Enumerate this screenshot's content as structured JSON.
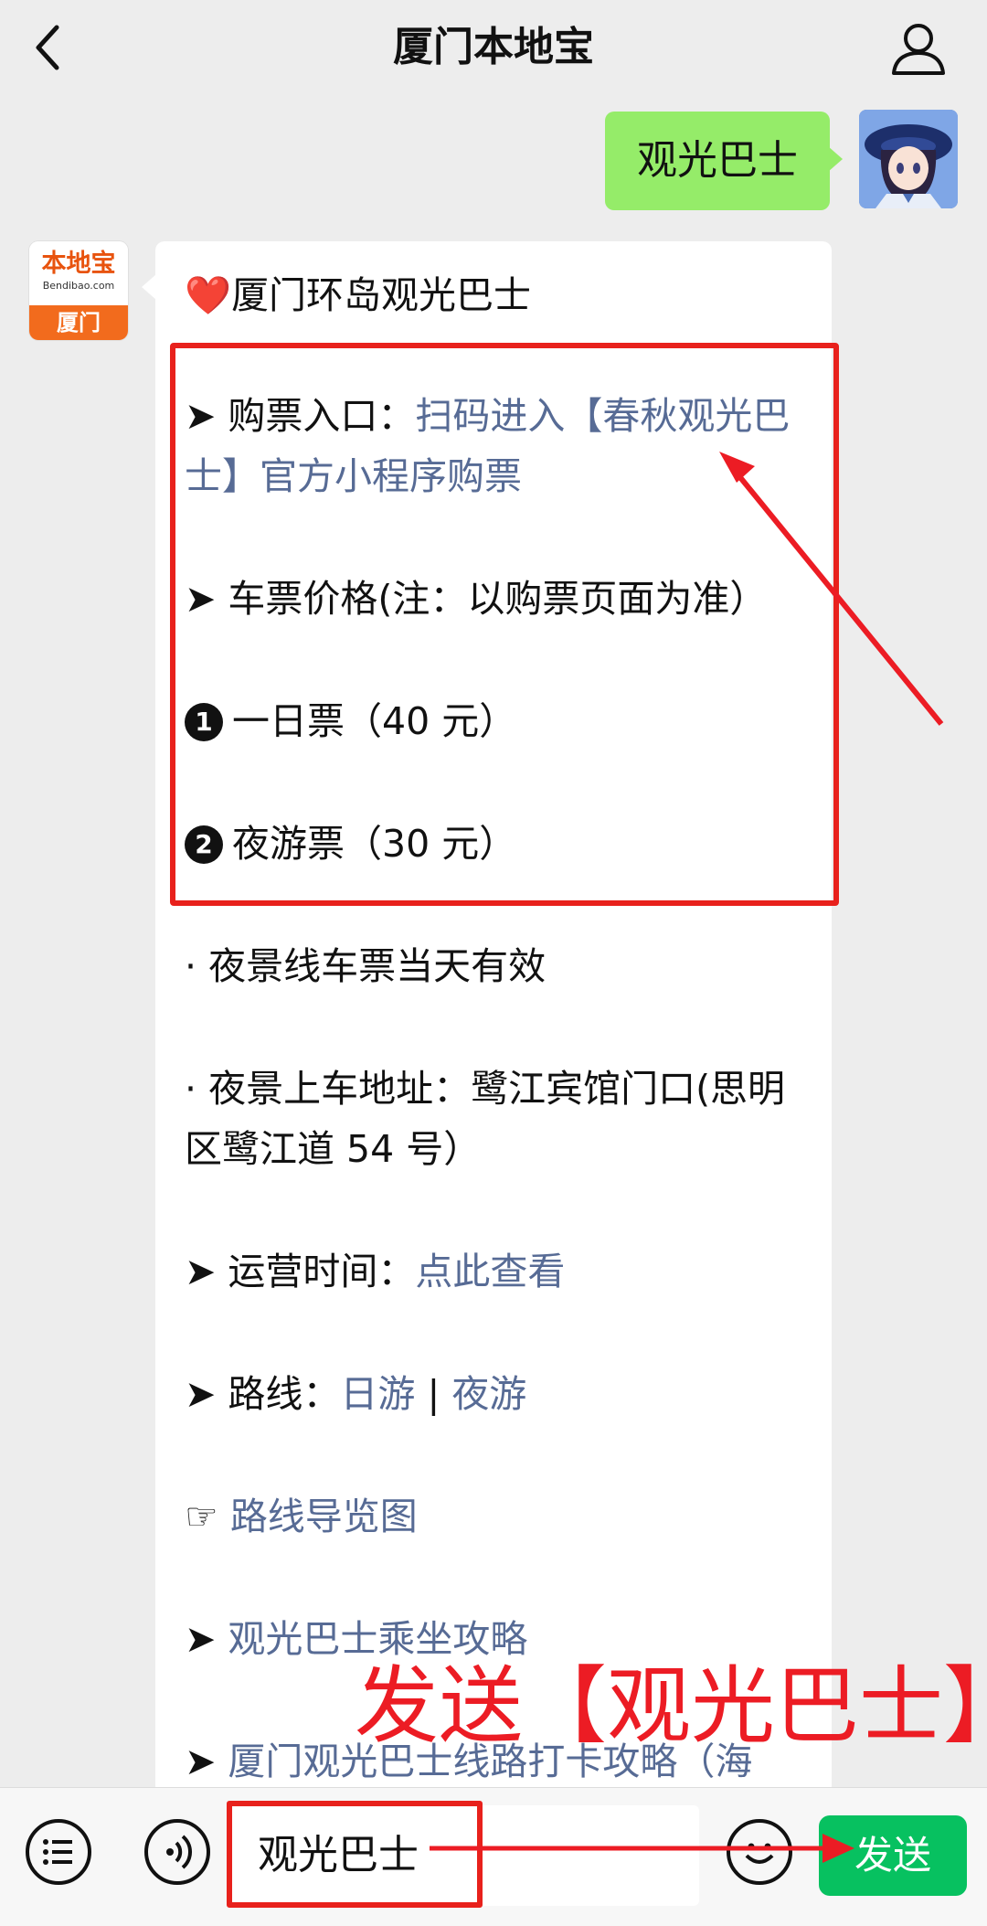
{
  "header": {
    "title": "厦门本地宝"
  },
  "user_message": {
    "text": "观光巴士"
  },
  "bot_avatar": {
    "logo": "本地宝",
    "site": "Bendibao.com",
    "city": "厦门"
  },
  "bot_message": {
    "title_icon": "❤️",
    "title": "厦门环岛观光巴士",
    "ticket_entry": {
      "label": "购票入口：",
      "link": "扫码进入【春秋观光巴士】官方小程序购票"
    },
    "price": "车票价格(注：以购票页面为准）",
    "ticket1": {
      "num": "1",
      "text": "一日票（40 元）"
    },
    "ticket2": {
      "num": "2",
      "text": "夜游票（30 元）"
    },
    "night_valid": "· 夜景线车票当天有效",
    "night_address": "· 夜景上车地址：鹭江宾馆门口(思明区鹭江道 54 号）",
    "hours": {
      "label": "运营时间：",
      "link": "点此查看"
    },
    "route": {
      "label": "路线：",
      "link1": "日游",
      "sep": "|",
      "link2": "夜游"
    },
    "route_map": {
      "icon": "☞",
      "link": "路线导览图"
    },
    "guide": {
      "link": "观光巴士乘坐攻略"
    },
    "checkin": {
      "link": "厦门观光巴士线路打卡攻略（海"
    }
  },
  "annotation": {
    "text": "发送【观光巴士】"
  },
  "input": {
    "value": "观光巴士"
  },
  "send_button": {
    "label": "发送"
  },
  "colors": {
    "accent_green": "#07c160",
    "bubble_green": "#95ec69",
    "link_blue": "#576b95",
    "annotation_red": "#e8211c"
  }
}
